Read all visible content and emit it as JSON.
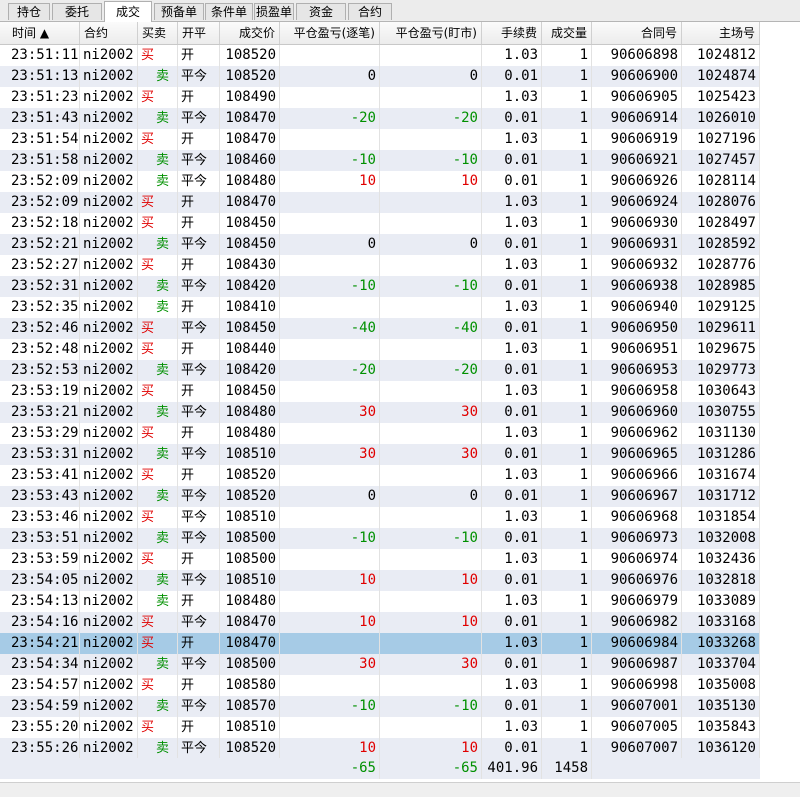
{
  "tabs": [
    {
      "label": "持仓",
      "active": false
    },
    {
      "label": "委托",
      "active": false
    },
    {
      "label": "成交",
      "active": true
    },
    {
      "label": "预备单",
      "active": false
    },
    {
      "label": "条件单",
      "active": false
    },
    {
      "label": "损盈单",
      "active": false
    },
    {
      "label": "资金",
      "active": false
    },
    {
      "label": "合约",
      "active": false
    }
  ],
  "columns": [
    "时间 ▲",
    "合约",
    "买卖",
    "开平",
    "成交价",
    "平仓盈亏(逐笔)",
    "平仓盈亏(盯市)",
    "手续费",
    "成交量",
    "合同号",
    "主场号"
  ],
  "rows": [
    {
      "time": "23:51:11",
      "contract": "ni2002",
      "side": "买",
      "oc": "开",
      "price": "108520",
      "pnl1": "",
      "pnl2": "",
      "fee": "1.03",
      "qty": "1",
      "order": "90606898",
      "match": "1024812"
    },
    {
      "time": "23:51:13",
      "contract": "ni2002",
      "side": "卖",
      "oc": "平今",
      "price": "108520",
      "pnl1": "0",
      "pnl2": "0",
      "fee": "0.01",
      "qty": "1",
      "order": "90606900",
      "match": "1024874"
    },
    {
      "time": "23:51:23",
      "contract": "ni2002",
      "side": "买",
      "oc": "开",
      "price": "108490",
      "pnl1": "",
      "pnl2": "",
      "fee": "1.03",
      "qty": "1",
      "order": "90606905",
      "match": "1025423"
    },
    {
      "time": "23:51:43",
      "contract": "ni2002",
      "side": "卖",
      "oc": "平今",
      "price": "108470",
      "pnl1": "-20",
      "pnl2": "-20",
      "fee": "0.01",
      "qty": "1",
      "order": "90606914",
      "match": "1026010"
    },
    {
      "time": "23:51:54",
      "contract": "ni2002",
      "side": "买",
      "oc": "开",
      "price": "108470",
      "pnl1": "",
      "pnl2": "",
      "fee": "1.03",
      "qty": "1",
      "order": "90606919",
      "match": "1027196"
    },
    {
      "time": "23:51:58",
      "contract": "ni2002",
      "side": "卖",
      "oc": "平今",
      "price": "108460",
      "pnl1": "-10",
      "pnl2": "-10",
      "fee": "0.01",
      "qty": "1",
      "order": "90606921",
      "match": "1027457"
    },
    {
      "time": "23:52:09",
      "contract": "ni2002",
      "side": "卖",
      "oc": "平今",
      "price": "108480",
      "pnl1": "10",
      "pnl2": "10",
      "fee": "0.01",
      "qty": "1",
      "order": "90606926",
      "match": "1028114"
    },
    {
      "time": "23:52:09",
      "contract": "ni2002",
      "side": "买",
      "oc": "开",
      "price": "108470",
      "pnl1": "",
      "pnl2": "",
      "fee": "1.03",
      "qty": "1",
      "order": "90606924",
      "match": "1028076"
    },
    {
      "time": "23:52:18",
      "contract": "ni2002",
      "side": "买",
      "oc": "开",
      "price": "108450",
      "pnl1": "",
      "pnl2": "",
      "fee": "1.03",
      "qty": "1",
      "order": "90606930",
      "match": "1028497"
    },
    {
      "time": "23:52:21",
      "contract": "ni2002",
      "side": "卖",
      "oc": "平今",
      "price": "108450",
      "pnl1": "0",
      "pnl2": "0",
      "fee": "0.01",
      "qty": "1",
      "order": "90606931",
      "match": "1028592"
    },
    {
      "time": "23:52:27",
      "contract": "ni2002",
      "side": "买",
      "oc": "开",
      "price": "108430",
      "pnl1": "",
      "pnl2": "",
      "fee": "1.03",
      "qty": "1",
      "order": "90606932",
      "match": "1028776"
    },
    {
      "time": "23:52:31",
      "contract": "ni2002",
      "side": "卖",
      "oc": "平今",
      "price": "108420",
      "pnl1": "-10",
      "pnl2": "-10",
      "fee": "0.01",
      "qty": "1",
      "order": "90606938",
      "match": "1028985"
    },
    {
      "time": "23:52:35",
      "contract": "ni2002",
      "side": "卖",
      "oc": "开",
      "price": "108410",
      "pnl1": "",
      "pnl2": "",
      "fee": "1.03",
      "qty": "1",
      "order": "90606940",
      "match": "1029125"
    },
    {
      "time": "23:52:46",
      "contract": "ni2002",
      "side": "买",
      "oc": "平今",
      "price": "108450",
      "pnl1": "-40",
      "pnl2": "-40",
      "fee": "0.01",
      "qty": "1",
      "order": "90606950",
      "match": "1029611"
    },
    {
      "time": "23:52:48",
      "contract": "ni2002",
      "side": "买",
      "oc": "开",
      "price": "108440",
      "pnl1": "",
      "pnl2": "",
      "fee": "1.03",
      "qty": "1",
      "order": "90606951",
      "match": "1029675"
    },
    {
      "time": "23:52:53",
      "contract": "ni2002",
      "side": "卖",
      "oc": "平今",
      "price": "108420",
      "pnl1": "-20",
      "pnl2": "-20",
      "fee": "0.01",
      "qty": "1",
      "order": "90606953",
      "match": "1029773"
    },
    {
      "time": "23:53:19",
      "contract": "ni2002",
      "side": "买",
      "oc": "开",
      "price": "108450",
      "pnl1": "",
      "pnl2": "",
      "fee": "1.03",
      "qty": "1",
      "order": "90606958",
      "match": "1030643"
    },
    {
      "time": "23:53:21",
      "contract": "ni2002",
      "side": "卖",
      "oc": "平今",
      "price": "108480",
      "pnl1": "30",
      "pnl2": "30",
      "fee": "0.01",
      "qty": "1",
      "order": "90606960",
      "match": "1030755"
    },
    {
      "time": "23:53:29",
      "contract": "ni2002",
      "side": "买",
      "oc": "开",
      "price": "108480",
      "pnl1": "",
      "pnl2": "",
      "fee": "1.03",
      "qty": "1",
      "order": "90606962",
      "match": "1031130"
    },
    {
      "time": "23:53:31",
      "contract": "ni2002",
      "side": "卖",
      "oc": "平今",
      "price": "108510",
      "pnl1": "30",
      "pnl2": "30",
      "fee": "0.01",
      "qty": "1",
      "order": "90606965",
      "match": "1031286"
    },
    {
      "time": "23:53:41",
      "contract": "ni2002",
      "side": "买",
      "oc": "开",
      "price": "108520",
      "pnl1": "",
      "pnl2": "",
      "fee": "1.03",
      "qty": "1",
      "order": "90606966",
      "match": "1031674"
    },
    {
      "time": "23:53:43",
      "contract": "ni2002",
      "side": "卖",
      "oc": "平今",
      "price": "108520",
      "pnl1": "0",
      "pnl2": "0",
      "fee": "0.01",
      "qty": "1",
      "order": "90606967",
      "match": "1031712"
    },
    {
      "time": "23:53:46",
      "contract": "ni2002",
      "side": "买",
      "oc": "平今",
      "price": "108510",
      "pnl1": "",
      "pnl2": "",
      "fee": "1.03",
      "qty": "1",
      "order": "90606968",
      "match": "1031854"
    },
    {
      "time": "23:53:51",
      "contract": "ni2002",
      "side": "卖",
      "oc": "平今",
      "price": "108500",
      "pnl1": "-10",
      "pnl2": "-10",
      "fee": "0.01",
      "qty": "1",
      "order": "90606973",
      "match": "1032008"
    },
    {
      "time": "23:53:59",
      "contract": "ni2002",
      "side": "买",
      "oc": "开",
      "price": "108500",
      "pnl1": "",
      "pnl2": "",
      "fee": "1.03",
      "qty": "1",
      "order": "90606974",
      "match": "1032436"
    },
    {
      "time": "23:54:05",
      "contract": "ni2002",
      "side": "卖",
      "oc": "平今",
      "price": "108510",
      "pnl1": "10",
      "pnl2": "10",
      "fee": "0.01",
      "qty": "1",
      "order": "90606976",
      "match": "1032818"
    },
    {
      "time": "23:54:13",
      "contract": "ni2002",
      "side": "卖",
      "oc": "开",
      "price": "108480",
      "pnl1": "",
      "pnl2": "",
      "fee": "1.03",
      "qty": "1",
      "order": "90606979",
      "match": "1033089"
    },
    {
      "time": "23:54:16",
      "contract": "ni2002",
      "side": "买",
      "oc": "平今",
      "price": "108470",
      "pnl1": "10",
      "pnl2": "10",
      "fee": "0.01",
      "qty": "1",
      "order": "90606982",
      "match": "1033168"
    },
    {
      "time": "23:54:21",
      "contract": "ni2002",
      "side": "买",
      "oc": "开",
      "price": "108470",
      "pnl1": "",
      "pnl2": "",
      "fee": "1.03",
      "qty": "1",
      "order": "90606984",
      "match": "1033268",
      "selected": true
    },
    {
      "time": "23:54:34",
      "contract": "ni2002",
      "side": "卖",
      "oc": "平今",
      "price": "108500",
      "pnl1": "30",
      "pnl2": "30",
      "fee": "0.01",
      "qty": "1",
      "order": "90606987",
      "match": "1033704"
    },
    {
      "time": "23:54:57",
      "contract": "ni2002",
      "side": "买",
      "oc": "开",
      "price": "108580",
      "pnl1": "",
      "pnl2": "",
      "fee": "1.03",
      "qty": "1",
      "order": "90606998",
      "match": "1035008"
    },
    {
      "time": "23:54:59",
      "contract": "ni2002",
      "side": "卖",
      "oc": "平今",
      "price": "108570",
      "pnl1": "-10",
      "pnl2": "-10",
      "fee": "0.01",
      "qty": "1",
      "order": "90607001",
      "match": "1035130"
    },
    {
      "time": "23:55:20",
      "contract": "ni2002",
      "side": "买",
      "oc": "开",
      "price": "108510",
      "pnl1": "",
      "pnl2": "",
      "fee": "1.03",
      "qty": "1",
      "order": "90607005",
      "match": "1035843"
    },
    {
      "time": "23:55:26",
      "contract": "ni2002",
      "side": "卖",
      "oc": "平今",
      "price": "108520",
      "pnl1": "10",
      "pnl2": "10",
      "fee": "0.01",
      "qty": "1",
      "order": "90607007",
      "match": "1036120"
    }
  ],
  "totals": {
    "pnl1": "-65",
    "pnl2": "-65",
    "fee": "401.96",
    "qty": "1458"
  },
  "colors": {
    "buy": "#e00000",
    "sell": "#009000",
    "selected_row": "#a6cbe6",
    "alt_row": "#e9ecf4"
  }
}
